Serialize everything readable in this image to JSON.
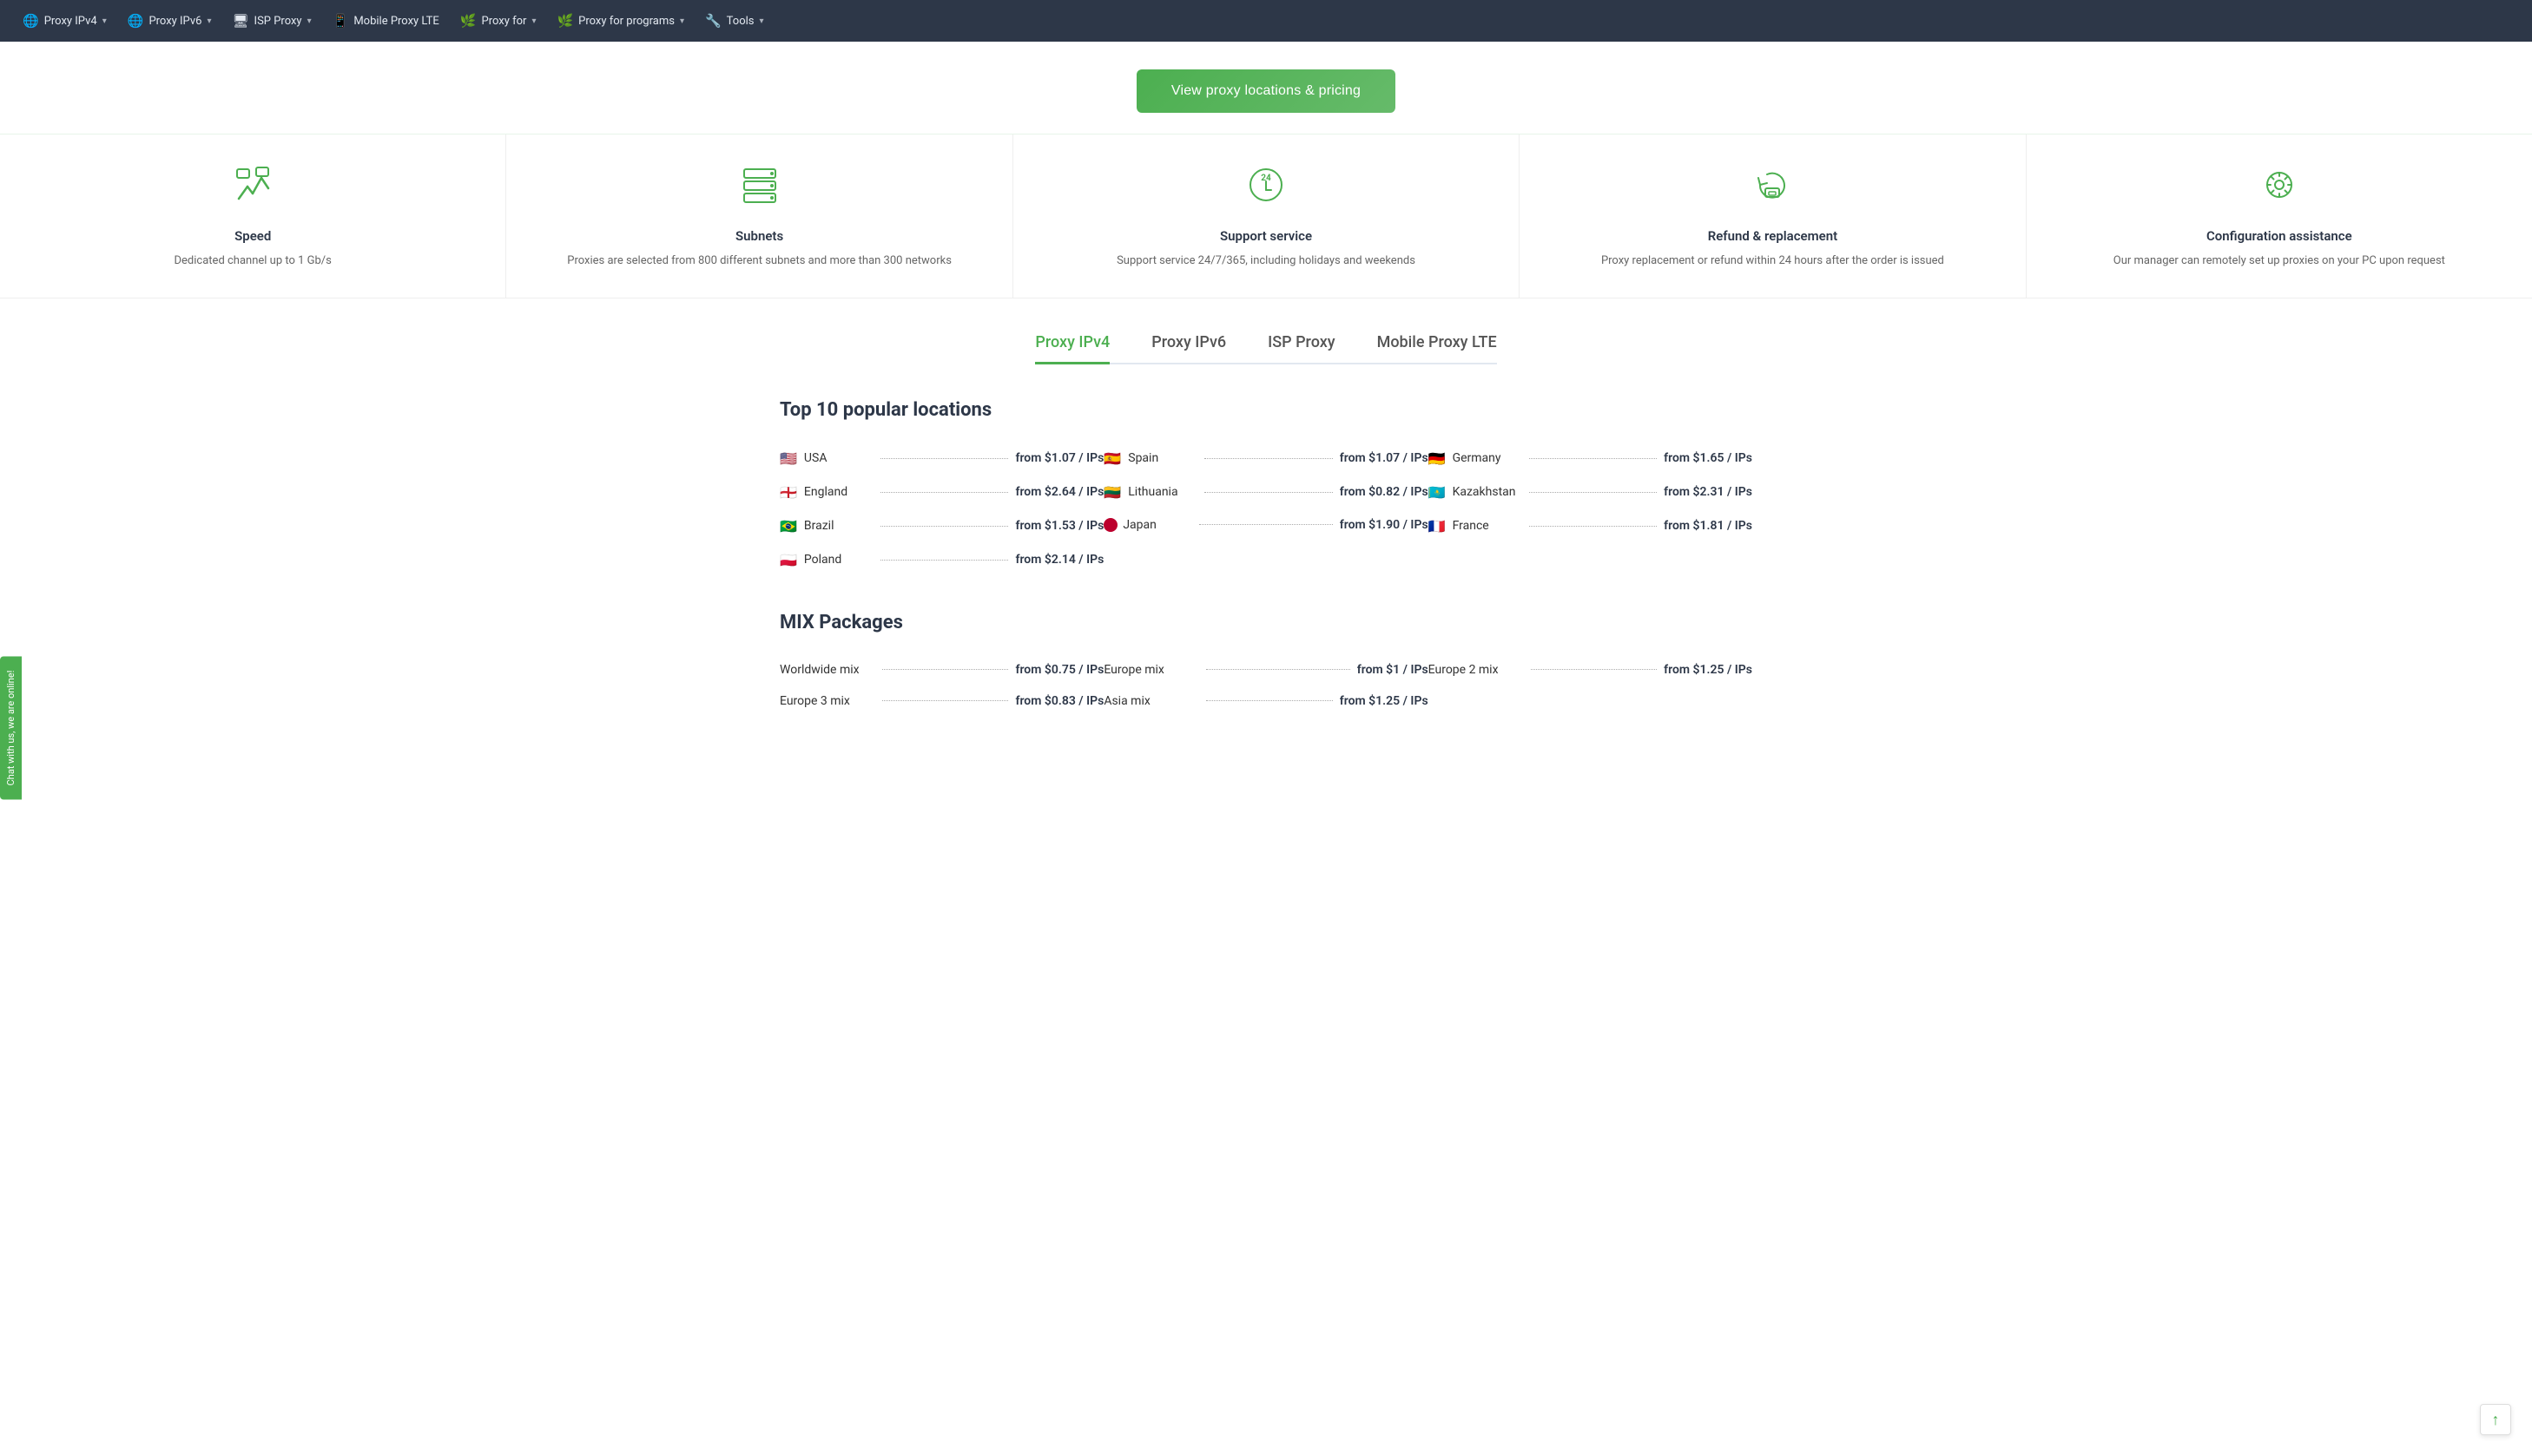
{
  "nav": {
    "items": [
      {
        "id": "proxy-ipv4",
        "label": "Proxy IPv4",
        "icon": "🌐",
        "hasDropdown": true
      },
      {
        "id": "proxy-ipv6",
        "label": "Proxy IPv6",
        "icon": "🌐",
        "hasDropdown": true
      },
      {
        "id": "isp-proxy",
        "label": "ISP Proxy",
        "icon": "🖥",
        "hasDropdown": true
      },
      {
        "id": "mobile-proxy-lte",
        "label": "Mobile Proxy LTE",
        "icon": "📱",
        "hasDropdown": false
      },
      {
        "id": "proxy-for",
        "label": "Proxy for",
        "icon": "🌿",
        "hasDropdown": true
      },
      {
        "id": "proxy-for-programs",
        "label": "Proxy for programs",
        "icon": "🌿",
        "hasDropdown": true
      },
      {
        "id": "tools",
        "label": "Tools",
        "icon": "🔧",
        "hasDropdown": true
      }
    ]
  },
  "hero": {
    "button_label": "View proxy locations & pricing"
  },
  "features": [
    {
      "id": "speed",
      "icon": "⚡",
      "title": "Speed",
      "description": "Dedicated channel up to 1 Gb/s"
    },
    {
      "id": "subnets",
      "icon": "🗄",
      "title": "Subnets",
      "description": "Proxies are selected from 800 different subnets and more than 300 networks"
    },
    {
      "id": "support",
      "icon": "🕐",
      "title": "Support service",
      "description": "Support service 24/7/365, including holidays and weekends"
    },
    {
      "id": "refund",
      "icon": "♻",
      "title": "Refund & replacement",
      "description": "Proxy replacement or refund within 24 hours after the order is issued"
    },
    {
      "id": "configuration",
      "icon": "⚙",
      "title": "Configuration assistance",
      "description": "Our manager can remotely set up proxies on your PC upon request"
    }
  ],
  "tabs": {
    "active": 0,
    "items": [
      {
        "id": "ipv4",
        "label": "Proxy IPv4"
      },
      {
        "id": "ipv6",
        "label": "Proxy IPv6"
      },
      {
        "id": "isp",
        "label": "ISP Proxy"
      },
      {
        "id": "mobile",
        "label": "Mobile Proxy LTE"
      }
    ]
  },
  "top_locations": {
    "title": "Top 10 popular locations",
    "locations": [
      {
        "flag": "🇺🇸",
        "name": "USA",
        "price": "from $1.07 / IPs"
      },
      {
        "flag": "🇪🇸",
        "name": "Spain",
        "price": "from $1.07 / IPs"
      },
      {
        "flag": "🇩🇪",
        "name": "Germany",
        "price": "from $1.65 / IPs"
      },
      {
        "flag": "🏴󠁧󠁢󠁥󠁮󠁧󠁿",
        "name": "England",
        "price": "from $2.64 / IPs"
      },
      {
        "flag": "🇱🇹",
        "name": "Lithuania",
        "price": "from $0.82 / IPs"
      },
      {
        "flag": "🇰🇿",
        "name": "Kazakhstan",
        "price": "from $2.31 / IPs"
      },
      {
        "flag": "🇧🇷",
        "name": "Brazil",
        "price": "from $1.53 / IPs"
      },
      {
        "flag": "⚫",
        "name": "Japan",
        "price": "from $1.90 / IPs",
        "dot": true
      },
      {
        "flag": "🇫🇷",
        "name": "France",
        "price": "from $1.81 / IPs"
      },
      {
        "flag": "🇵🇱",
        "name": "Poland",
        "price": "from $2.14 / IPs"
      }
    ]
  },
  "mix_packages": {
    "title": "MIX Packages",
    "packages": [
      {
        "name": "Worldwide mix",
        "price": "from $0.75 / IPs"
      },
      {
        "name": "Europe mix",
        "price": "from $1 / IPs"
      },
      {
        "name": "Europe 2 mix",
        "price": "from $1.25 / IPs"
      },
      {
        "name": "Europe 3 mix",
        "price": "from $0.83 / IPs"
      },
      {
        "name": "Asia mix",
        "price": "from $1.25 / IPs"
      }
    ]
  },
  "chat": {
    "label": "Chat with us, we are online!"
  },
  "scroll_top": {
    "icon": "↑"
  }
}
